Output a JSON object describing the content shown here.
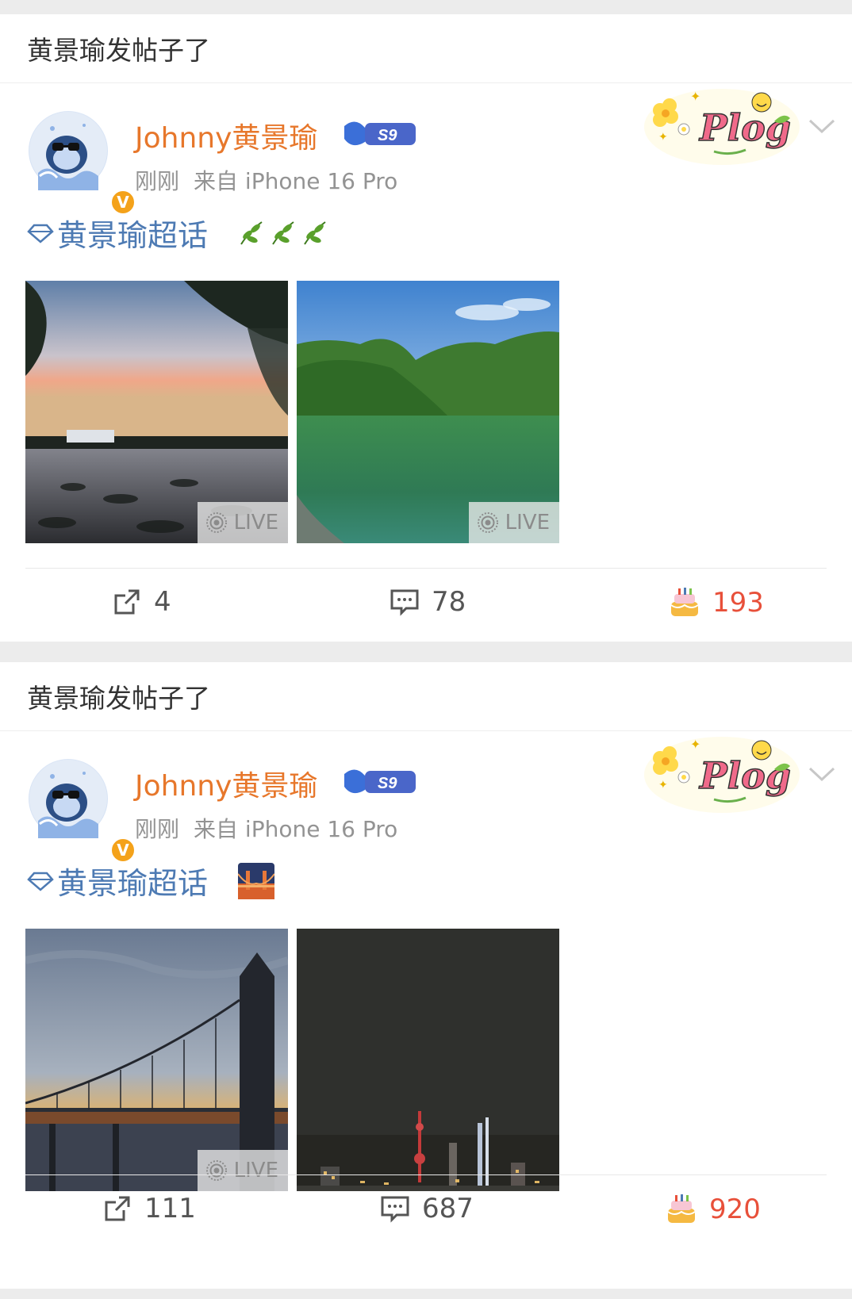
{
  "posts": [
    {
      "header": "黄景瑜发帖子了",
      "username": "Johnny黄景瑜",
      "level_badge": "S9",
      "time": "刚刚",
      "source": "来自 iPhone 16 Pro",
      "topic": "黄景瑜超话",
      "topic_emoji": "leaves",
      "photos": [
        {
          "scene": "sunset-lake-willow",
          "live_label": "LIVE"
        },
        {
          "scene": "green-mountain-lake",
          "live_label": "LIVE"
        }
      ],
      "actions": {
        "repost": "4",
        "comment": "78",
        "like": "193"
      },
      "verified_mark": "V",
      "sticker_text": "Plog"
    },
    {
      "header": "黄景瑜发帖子了",
      "username": "Johnny黄景瑜",
      "level_badge": "S9",
      "time": "刚刚",
      "source": "来自 iPhone 16 Pro",
      "topic": "黄景瑜超话",
      "topic_emoji": "bridge-at-night",
      "photos": [
        {
          "scene": "suspension-bridge-dusk",
          "live_label": "LIVE"
        },
        {
          "scene": "city-skyline-night",
          "live_label": ""
        }
      ],
      "actions": {
        "repost": "111",
        "comment": "687",
        "like": "920"
      },
      "verified_mark": "V",
      "sticker_text": "Plog"
    }
  ],
  "colors": {
    "username": "#e7772b",
    "topic": "#4d7ab3",
    "like_count": "#e8503a",
    "meta": "#939393",
    "background": "#ececec"
  }
}
